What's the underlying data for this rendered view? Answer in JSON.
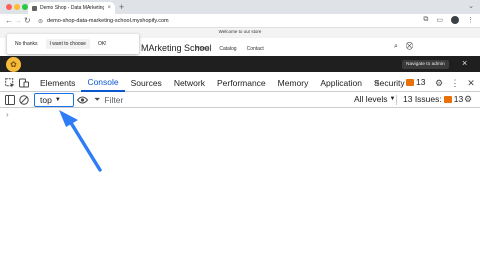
{
  "browser": {
    "traffic_colors": [
      "#ff5f57",
      "#febc2e",
      "#28c840"
    ],
    "tab_title": "Demo Shop - Data MArketing",
    "tab_close": "×",
    "new_tab": "+",
    "url": "demo-shop-data-marketing-school.myshopify.com"
  },
  "page": {
    "announcement": "Welcome to our store",
    "store_name": "Demo Shop - Data MArketing School",
    "nav_items": [
      "Home",
      "Catalog",
      "Contact"
    ],
    "consent": {
      "no_thanks": "No thanks",
      "want_to_choose": "I want to choose",
      "ok": "OK!"
    }
  },
  "notify": {
    "button": "Navigate to admin",
    "close": "×"
  },
  "devtools": {
    "tabs": [
      "Elements",
      "Console",
      "Sources",
      "Network",
      "Performance",
      "Memory",
      "Application",
      "Security"
    ],
    "active_tab": "Console",
    "more": "»",
    "issue_count_top": "13",
    "context_value": "top",
    "filter_placeholder": "Filter",
    "levels_label": "All levels",
    "issues_label": "13 Issues:",
    "issues_count": "13",
    "prompt": "›"
  },
  "colors": {
    "accent": "#1a73e8",
    "arrow": "#2f7df6",
    "warning": "#e8710a",
    "notify_bg": "#1f1f1f"
  }
}
